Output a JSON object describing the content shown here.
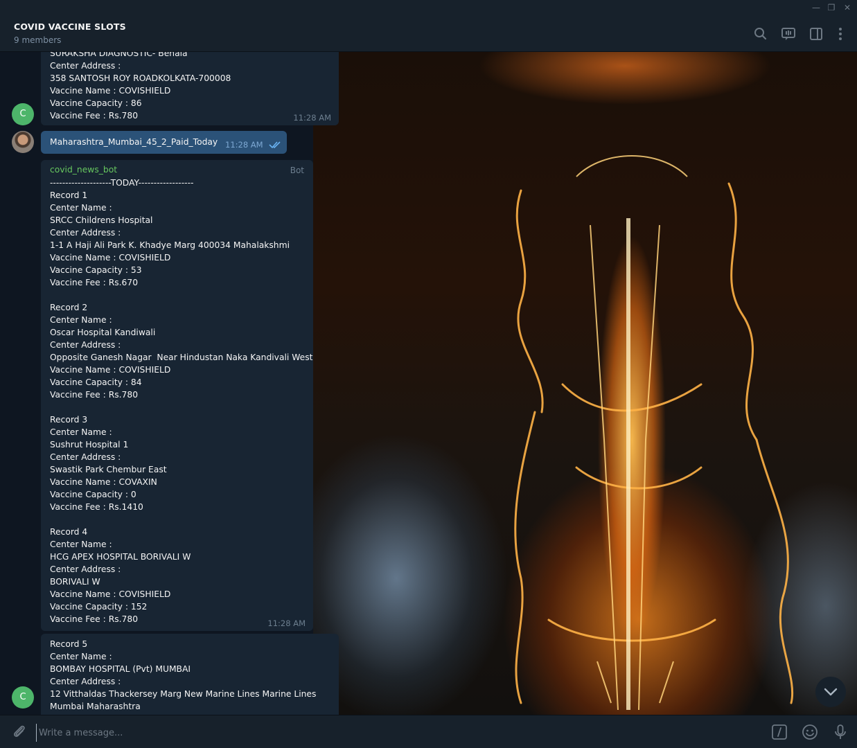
{
  "window": {
    "controls": [
      "—",
      "❐",
      "✕"
    ]
  },
  "header": {
    "title": "COVID VACCINE SLOTS",
    "subtitle": "9 members"
  },
  "messages": {
    "m1": {
      "lines": [
        "SURAKSHA DIAGNOSTIC- Behala",
        "Center Address :",
        "358 SANTOSH ROY ROADKOLKATA-700008",
        "Vaccine Name : COVISHIELD",
        "Vaccine Capacity : 86",
        "Vaccine Fee : Rs.780"
      ],
      "time": "11:28 AM",
      "avatar_letter": "C"
    },
    "m2": {
      "text": "Maharashtra_Mumbai_45_2_Paid_Today",
      "time": "11:28 AM"
    },
    "m3": {
      "sender": "covid_news_bot",
      "tag": "Bot",
      "lines": [
        "--------------------TODAY------------------",
        "Record 1",
        "Center Name :",
        "SRCC Childrens Hospital",
        "Center Address :",
        "1-1 A Haji Ali Park K. Khadye Marg 400034 Mahalakshmi",
        "Vaccine Name : COVISHIELD",
        "Vaccine Capacity : 53",
        "Vaccine Fee : Rs.670",
        "",
        "Record 2",
        "Center Name :",
        "Oscar Hospital Kandiwali",
        "Center Address :",
        "Opposite Ganesh Nagar  Near Hindustan Naka Kandivali West",
        "Vaccine Name : COVISHIELD",
        "Vaccine Capacity : 84",
        "Vaccine Fee : Rs.780",
        "",
        "Record 3",
        "Center Name :",
        "Sushrut Hospital 1",
        "Center Address :",
        "Swastik Park Chembur East",
        "Vaccine Name : COVAXIN",
        "Vaccine Capacity : 0",
        "Vaccine Fee : Rs.1410",
        "",
        "Record 4",
        "Center Name :",
        "HCG APEX HOSPITAL BORIVALI W",
        "Center Address :",
        "BORIVALI W",
        "Vaccine Name : COVISHIELD",
        "Vaccine Capacity : 152",
        "Vaccine Fee : Rs.780"
      ],
      "time": "11:28 AM"
    },
    "m4": {
      "lines": [
        "Record 5",
        "Center Name :",
        "BOMBAY HOSPITAL (Pvt) MUMBAI",
        "Center Address :",
        "12 Vitthaldas Thackersey Marg New Marine Lines Marine Lines",
        "Mumbai Maharashtra"
      ],
      "avatar_letter": "C"
    }
  },
  "composer": {
    "placeholder": "Write a message..."
  },
  "colors": {
    "accent": "#2b5278",
    "bubble": "#182533",
    "sender": "#67c75f",
    "avatar": "#4db56a"
  }
}
